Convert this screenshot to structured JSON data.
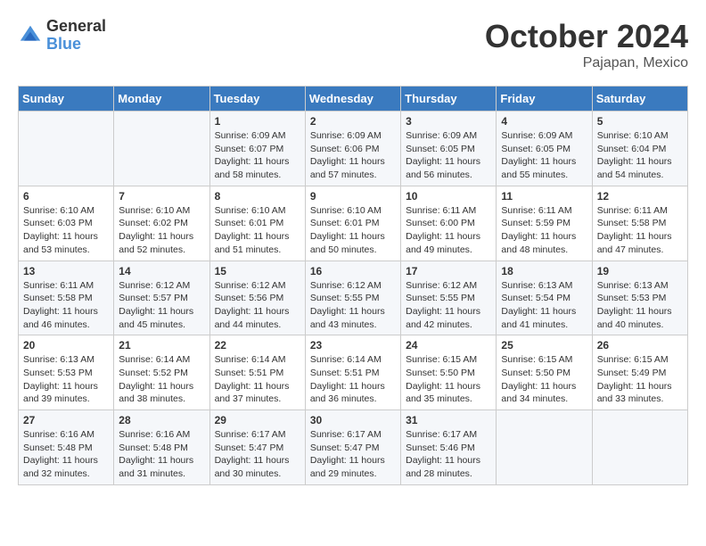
{
  "logo": {
    "general": "General",
    "blue": "Blue"
  },
  "header": {
    "month": "October 2024",
    "location": "Pajapan, Mexico"
  },
  "weekdays": [
    "Sunday",
    "Monday",
    "Tuesday",
    "Wednesday",
    "Thursday",
    "Friday",
    "Saturday"
  ],
  "weeks": [
    [
      {
        "day": "",
        "detail": ""
      },
      {
        "day": "",
        "detail": ""
      },
      {
        "day": "1",
        "detail": "Sunrise: 6:09 AM\nSunset: 6:07 PM\nDaylight: 11 hours\nand 58 minutes."
      },
      {
        "day": "2",
        "detail": "Sunrise: 6:09 AM\nSunset: 6:06 PM\nDaylight: 11 hours\nand 57 minutes."
      },
      {
        "day": "3",
        "detail": "Sunrise: 6:09 AM\nSunset: 6:05 PM\nDaylight: 11 hours\nand 56 minutes."
      },
      {
        "day": "4",
        "detail": "Sunrise: 6:09 AM\nSunset: 6:05 PM\nDaylight: 11 hours\nand 55 minutes."
      },
      {
        "day": "5",
        "detail": "Sunrise: 6:10 AM\nSunset: 6:04 PM\nDaylight: 11 hours\nand 54 minutes."
      }
    ],
    [
      {
        "day": "6",
        "detail": "Sunrise: 6:10 AM\nSunset: 6:03 PM\nDaylight: 11 hours\nand 53 minutes."
      },
      {
        "day": "7",
        "detail": "Sunrise: 6:10 AM\nSunset: 6:02 PM\nDaylight: 11 hours\nand 52 minutes."
      },
      {
        "day": "8",
        "detail": "Sunrise: 6:10 AM\nSunset: 6:01 PM\nDaylight: 11 hours\nand 51 minutes."
      },
      {
        "day": "9",
        "detail": "Sunrise: 6:10 AM\nSunset: 6:01 PM\nDaylight: 11 hours\nand 50 minutes."
      },
      {
        "day": "10",
        "detail": "Sunrise: 6:11 AM\nSunset: 6:00 PM\nDaylight: 11 hours\nand 49 minutes."
      },
      {
        "day": "11",
        "detail": "Sunrise: 6:11 AM\nSunset: 5:59 PM\nDaylight: 11 hours\nand 48 minutes."
      },
      {
        "day": "12",
        "detail": "Sunrise: 6:11 AM\nSunset: 5:58 PM\nDaylight: 11 hours\nand 47 minutes."
      }
    ],
    [
      {
        "day": "13",
        "detail": "Sunrise: 6:11 AM\nSunset: 5:58 PM\nDaylight: 11 hours\nand 46 minutes."
      },
      {
        "day": "14",
        "detail": "Sunrise: 6:12 AM\nSunset: 5:57 PM\nDaylight: 11 hours\nand 45 minutes."
      },
      {
        "day": "15",
        "detail": "Sunrise: 6:12 AM\nSunset: 5:56 PM\nDaylight: 11 hours\nand 44 minutes."
      },
      {
        "day": "16",
        "detail": "Sunrise: 6:12 AM\nSunset: 5:55 PM\nDaylight: 11 hours\nand 43 minutes."
      },
      {
        "day": "17",
        "detail": "Sunrise: 6:12 AM\nSunset: 5:55 PM\nDaylight: 11 hours\nand 42 minutes."
      },
      {
        "day": "18",
        "detail": "Sunrise: 6:13 AM\nSunset: 5:54 PM\nDaylight: 11 hours\nand 41 minutes."
      },
      {
        "day": "19",
        "detail": "Sunrise: 6:13 AM\nSunset: 5:53 PM\nDaylight: 11 hours\nand 40 minutes."
      }
    ],
    [
      {
        "day": "20",
        "detail": "Sunrise: 6:13 AM\nSunset: 5:53 PM\nDaylight: 11 hours\nand 39 minutes."
      },
      {
        "day": "21",
        "detail": "Sunrise: 6:14 AM\nSunset: 5:52 PM\nDaylight: 11 hours\nand 38 minutes."
      },
      {
        "day": "22",
        "detail": "Sunrise: 6:14 AM\nSunset: 5:51 PM\nDaylight: 11 hours\nand 37 minutes."
      },
      {
        "day": "23",
        "detail": "Sunrise: 6:14 AM\nSunset: 5:51 PM\nDaylight: 11 hours\nand 36 minutes."
      },
      {
        "day": "24",
        "detail": "Sunrise: 6:15 AM\nSunset: 5:50 PM\nDaylight: 11 hours\nand 35 minutes."
      },
      {
        "day": "25",
        "detail": "Sunrise: 6:15 AM\nSunset: 5:50 PM\nDaylight: 11 hours\nand 34 minutes."
      },
      {
        "day": "26",
        "detail": "Sunrise: 6:15 AM\nSunset: 5:49 PM\nDaylight: 11 hours\nand 33 minutes."
      }
    ],
    [
      {
        "day": "27",
        "detail": "Sunrise: 6:16 AM\nSunset: 5:48 PM\nDaylight: 11 hours\nand 32 minutes."
      },
      {
        "day": "28",
        "detail": "Sunrise: 6:16 AM\nSunset: 5:48 PM\nDaylight: 11 hours\nand 31 minutes."
      },
      {
        "day": "29",
        "detail": "Sunrise: 6:17 AM\nSunset: 5:47 PM\nDaylight: 11 hours\nand 30 minutes."
      },
      {
        "day": "30",
        "detail": "Sunrise: 6:17 AM\nSunset: 5:47 PM\nDaylight: 11 hours\nand 29 minutes."
      },
      {
        "day": "31",
        "detail": "Sunrise: 6:17 AM\nSunset: 5:46 PM\nDaylight: 11 hours\nand 28 minutes."
      },
      {
        "day": "",
        "detail": ""
      },
      {
        "day": "",
        "detail": ""
      }
    ]
  ]
}
